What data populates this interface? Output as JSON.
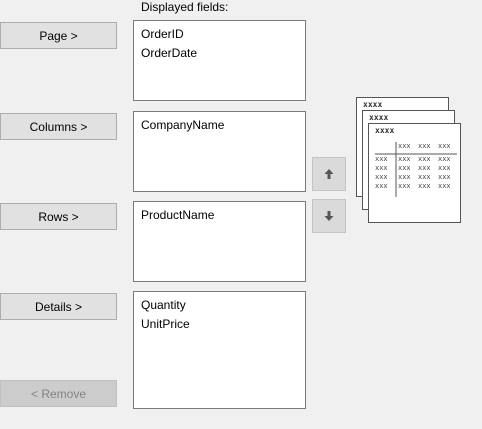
{
  "displayed_fields_label": "Displayed fields:",
  "buttons": {
    "page": "Page >",
    "columns": "Columns >",
    "rows": "Rows >",
    "details": "Details >",
    "remove": "< Remove"
  },
  "lists": {
    "page": [
      "OrderID",
      "OrderDate"
    ],
    "columns": [
      "CompanyName"
    ],
    "rows": [
      "ProductName"
    ],
    "details": [
      "Quantity",
      "UnitPrice"
    ]
  },
  "icons": {
    "move_up": "arrow-up-icon",
    "move_down": "arrow-down-icon",
    "preview": "pivot-preview-icon"
  },
  "preview": {
    "sheet_tag": "xxxx",
    "cell_text": "xxx"
  }
}
